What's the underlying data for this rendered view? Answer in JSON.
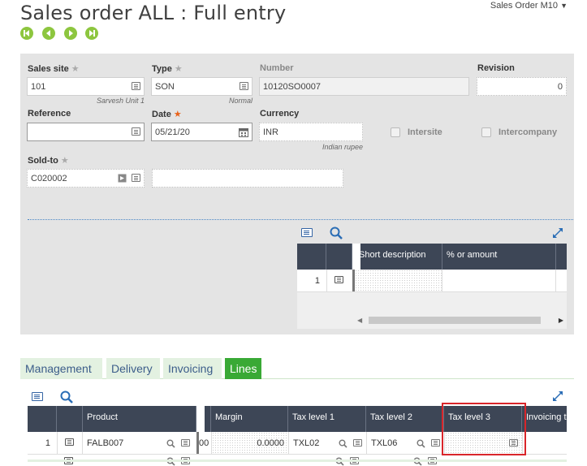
{
  "page": {
    "title": "Sales order ALL : Full entry",
    "menu_label": "Sales Order M10"
  },
  "header": {
    "sales_site": {
      "label": "Sales site",
      "value": "101",
      "sub": "Sarvesh Unit 1"
    },
    "type": {
      "label": "Type",
      "value": "SON",
      "sub": "Normal"
    },
    "number": {
      "label": "Number",
      "value": "10120SO0007"
    },
    "revision": {
      "label": "Revision",
      "value": "0"
    },
    "reference": {
      "label": "Reference",
      "value": ""
    },
    "date": {
      "label": "Date",
      "value": "05/21/20"
    },
    "currency": {
      "label": "Currency",
      "value": "INR",
      "sub": "Indian rupee"
    },
    "intersite": {
      "label": "Intersite",
      "checked": false
    },
    "intercompany": {
      "label": "Intercompany",
      "checked": false
    },
    "sold_to": {
      "label": "Sold-to",
      "value": "C020002",
      "name": ""
    }
  },
  "desc_grid": {
    "columns": [
      "Short description",
      "% or amount"
    ],
    "rows": [
      {
        "num": "1",
        "short_description": "",
        "percent_or_amount": ""
      }
    ]
  },
  "tabs": [
    {
      "label": "Management",
      "active": false
    },
    {
      "label": "Delivery",
      "active": false
    },
    {
      "label": "Invoicing",
      "active": false
    },
    {
      "label": "Lines",
      "active": true
    }
  ],
  "lines_grid": {
    "columns": [
      "Product",
      "Margin",
      "Tax level 1",
      "Tax level 2",
      "Tax level 3",
      "Invoicing t"
    ],
    "rows": [
      {
        "num": "1",
        "product": "FALB007",
        "hidden_stub": "00",
        "margin": "0.0000",
        "tax1": "TXL02",
        "tax2": "TXL06",
        "tax3": ""
      }
    ]
  },
  "colors": {
    "accent_green": "#39a935",
    "nav_green": "#8dc63f",
    "grid_header": "#3d4656",
    "highlight": "#d9252a"
  }
}
